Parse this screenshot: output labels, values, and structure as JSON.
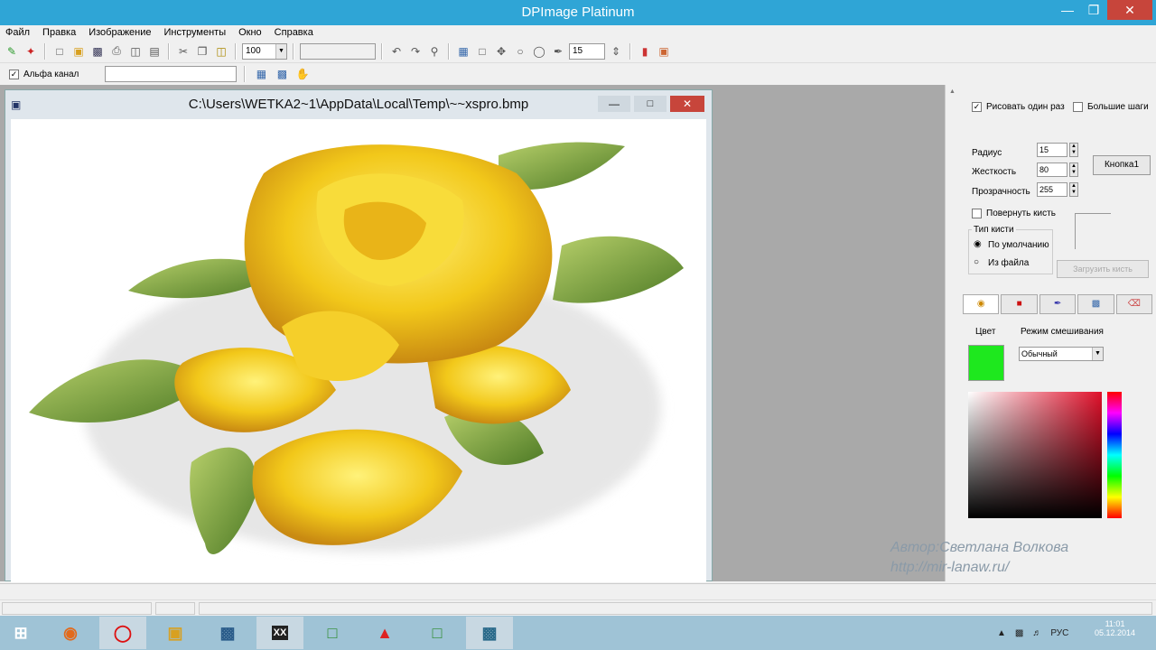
{
  "window": {
    "title": "DPImage Platinum"
  },
  "menu": [
    "Файл",
    "Правка",
    "Изображение",
    "Инструменты",
    "Окно",
    "Справка"
  ],
  "toolbar": {
    "zoom_value": "100",
    "brush_size_value": "15"
  },
  "toolbar2": {
    "alpha_label": "Альфа канал"
  },
  "document": {
    "title": "C:\\Users\\WETKA2~1\\AppData\\Local\\Temp\\~~xspro.bmp"
  },
  "panel": {
    "draw_once_label": "Рисовать один раз",
    "big_steps_label": "Большие шаги",
    "radius_label": "Радиус",
    "radius_value": "15",
    "hardness_label": "Жесткость",
    "hardness_value": "80",
    "opacity_label": "Прозрачность",
    "opacity_value": "255",
    "button1_label": "Кнопка1",
    "rotate_brush_label": "Повернуть кисть",
    "brush_type_label": "Тип кисти",
    "default_label": "По умолчанию",
    "from_file_label": "Из файла",
    "load_brush_label": "Загрузить кисть",
    "color_label": "Цвет",
    "blend_mode_label": "Режим смешивания",
    "blend_mode_value": "Обычный",
    "current_color": "#1ee81e"
  },
  "watermark": {
    "line1": "Автор:Светлана Волкова",
    "line2": "http://mir-lanaw.ru/"
  },
  "taskbar": {
    "lang": "РУС",
    "time": "11:01",
    "date": "05.12.2014"
  }
}
